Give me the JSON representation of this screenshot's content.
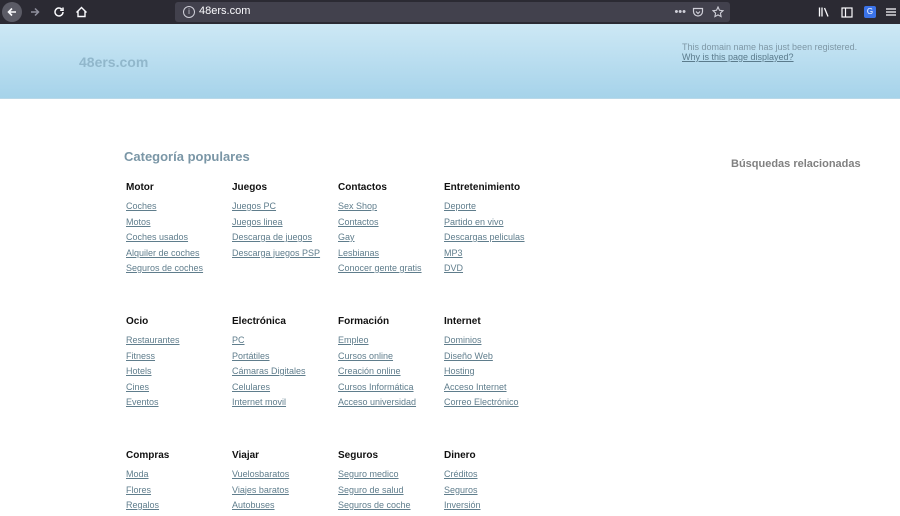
{
  "browser": {
    "url": "48ers.com",
    "info_glyph": "i",
    "overflow_glyph": "•••",
    "translate_glyph": "G"
  },
  "banner": {
    "brand": "48ers.com",
    "notice": "This domain name has just been registered.",
    "link": "Why is this page displayed?"
  },
  "main": {
    "title": "Categoría populares",
    "related": "Búsquedas relacionadas",
    "categories": [
      {
        "name": "Motor",
        "links": [
          "Coches",
          "Motos",
          "Coches usados",
          "Alquiler de coches",
          "Seguros de coches"
        ]
      },
      {
        "name": "Juegos",
        "links": [
          "Juegos PC",
          "Juegos linea",
          "Descarga de juegos",
          "Descarga juegos PSP"
        ]
      },
      {
        "name": "Contactos",
        "links": [
          "Sex Shop",
          "Contactos",
          "Gay",
          "Lesbianas",
          "Conocer gente gratis"
        ]
      },
      {
        "name": "Entretenimiento",
        "links": [
          "Deporte",
          "Partido en vivo",
          "Descargas peliculas",
          "MP3",
          "DVD"
        ]
      },
      {
        "name": "Ocio",
        "links": [
          "Restaurantes",
          "Fitness",
          "Hotels",
          "Cines",
          "Eventos"
        ]
      },
      {
        "name": "Electrónica",
        "links": [
          "PC",
          "Portátiles",
          "Cámaras Digitales",
          "Celulares",
          "Internet movil"
        ]
      },
      {
        "name": "Formación",
        "links": [
          "Empleo",
          "Cursos online",
          "Creación online",
          "Cursos Informática",
          "Acceso universidad"
        ]
      },
      {
        "name": "Internet",
        "links": [
          "Dominios",
          "Diseño Web",
          "Hosting",
          "Acceso Internet",
          "Correo Electrónico"
        ]
      },
      {
        "name": "Compras",
        "links": [
          "Moda",
          "Flores",
          "Regalos"
        ]
      },
      {
        "name": "Viajar",
        "links": [
          "Vuelosbaratos",
          "Viajes baratos",
          "Autobuses"
        ]
      },
      {
        "name": "Seguros",
        "links": [
          "Seguro medico",
          "Seguro de salud",
          "Seguros de coche"
        ]
      },
      {
        "name": "Dinero",
        "links": [
          "Créditos",
          "Seguros",
          "Inversión"
        ]
      }
    ]
  }
}
